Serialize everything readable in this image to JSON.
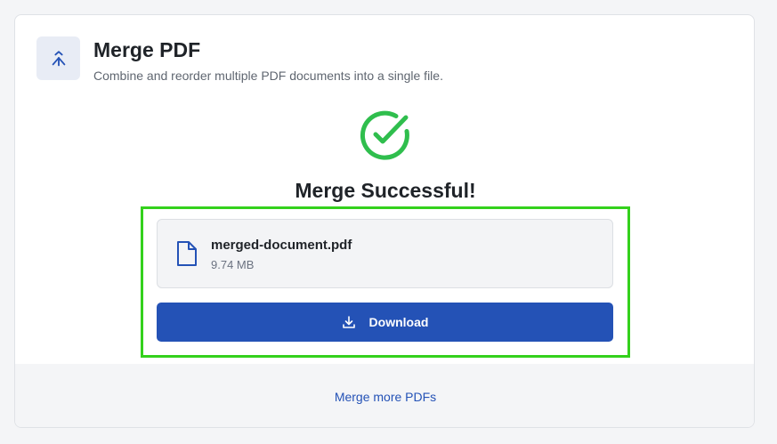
{
  "header": {
    "title": "Merge PDF",
    "subtitle": "Combine and reorder multiple PDF documents into a single file.",
    "icon": "merge-icon"
  },
  "result": {
    "heading": "Merge Successful!",
    "icon": "check-circle-icon",
    "success_color": "#2fbe4d"
  },
  "file": {
    "name": "merged-document.pdf",
    "size": "9.74 MB",
    "icon": "file-icon"
  },
  "actions": {
    "download_label": "Download",
    "download_icon": "download-icon",
    "merge_more_label": "Merge more PDFs"
  },
  "colors": {
    "accent": "#2452b6",
    "highlight": "#34d11c"
  }
}
